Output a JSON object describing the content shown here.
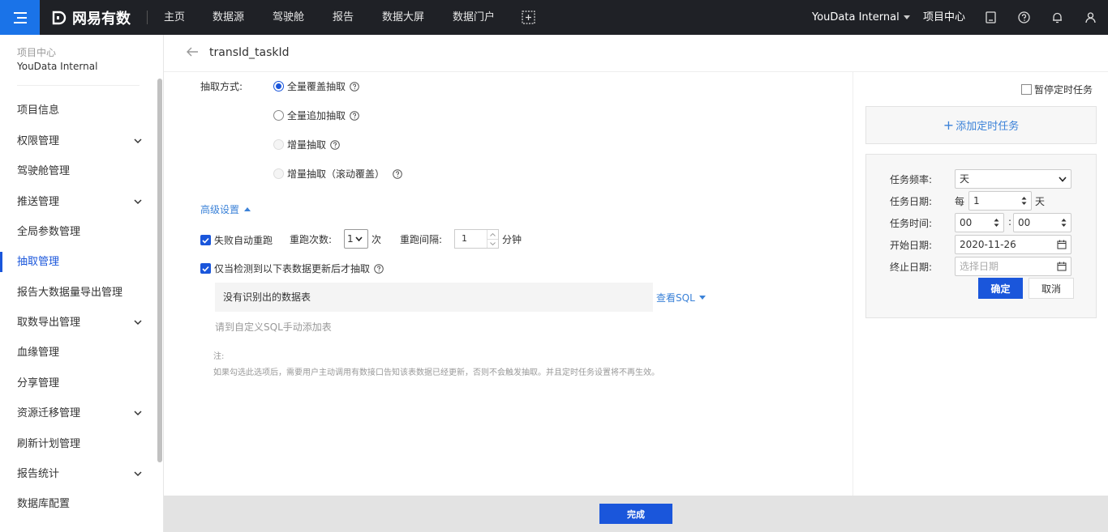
{
  "topbar": {
    "logo_text": "网易有数",
    "nav": [
      "主页",
      "数据源",
      "驾驶舱",
      "报告",
      "数据大屏",
      "数据门户"
    ],
    "project": "YouData Internal",
    "project_center": "项目中心"
  },
  "sidebar": {
    "section": "项目中心",
    "project": "YouData Internal",
    "items": [
      {
        "label": "项目信息"
      },
      {
        "label": "权限管理"
      },
      {
        "label": "驾驶舱管理"
      },
      {
        "label": "推送管理"
      },
      {
        "label": "全局参数管理"
      },
      {
        "label": "抽取管理"
      },
      {
        "label": "报告大数据量导出管理"
      },
      {
        "label": "取数导出管理"
      },
      {
        "label": "血缘管理"
      },
      {
        "label": "分享管理"
      },
      {
        "label": "资源迁移管理"
      },
      {
        "label": "刷新计划管理"
      },
      {
        "label": "报告统计"
      },
      {
        "label": "数据库配置"
      }
    ]
  },
  "header": {
    "title": "transId_taskId"
  },
  "form": {
    "extract_label": "抽取方式:",
    "options": [
      "全量覆盖抽取",
      "全量追加抽取",
      "增量抽取",
      "增量抽取（滚动覆盖）"
    ],
    "advanced": "高级设置",
    "retry_label": "失败自动重跑",
    "retry_count_label": "重跑次数:",
    "retry_count": "1",
    "retry_count_unit": "次",
    "retry_interval_label": "重跑间隔:",
    "retry_interval": "1",
    "retry_interval_unit": "分钟",
    "detect_label": "仅当检测到以下表数据更新后才抽取",
    "no_tables": "没有识别出的数据表",
    "view_sql": "查看SQL",
    "hint": "请到自定义SQL手动添加表",
    "note_label": "注:",
    "note": "如果勾选此选项后，需要用户主动调用有数接口告知该表数据已经更新，否则不会触发抽取。并且定时任务设置将不再生效。"
  },
  "schedule": {
    "pause": "暂停定时任务",
    "add_task": "添加定时任务",
    "freq_label": "任务频率:",
    "freq_value": "天",
    "date_label": "任务日期:",
    "date_prefix": "每",
    "date_value": "1",
    "date_suffix": "天",
    "time_label": "任务时间:",
    "hour": "00",
    "minute": "00",
    "time_sep": ":",
    "start_label": "开始日期:",
    "start_value": "2020-11-26",
    "end_label": "终止日期:",
    "end_placeholder": "选择日期",
    "ok": "确定",
    "cancel": "取消"
  },
  "footer": {
    "done": "完成"
  },
  "colors": {
    "primary": "#1a56db",
    "link": "#3b82d8",
    "topbar": "#1f2126"
  }
}
